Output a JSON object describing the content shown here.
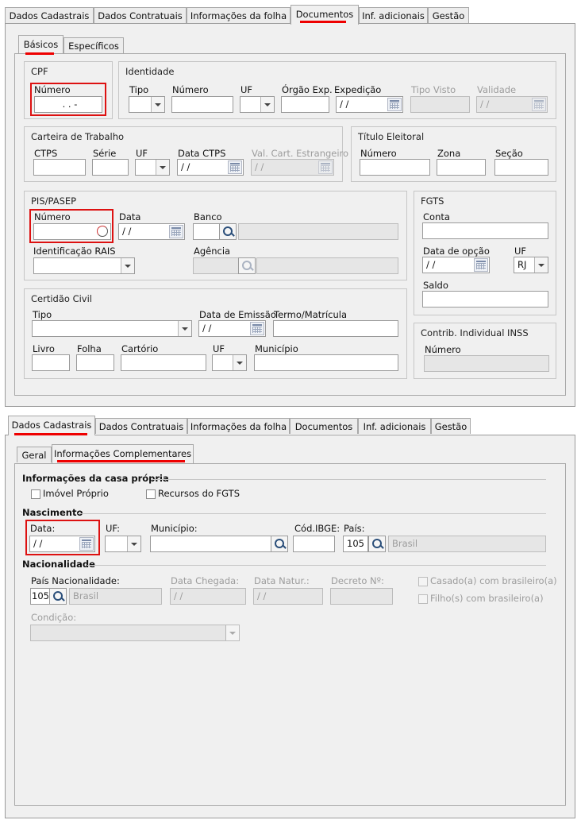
{
  "top": {
    "tabs": [
      "Dados Cadastrais",
      "Dados Contratuais",
      "Informações da folha",
      "Documentos",
      "Inf. adicionais",
      "Gestão"
    ],
    "subtabs": [
      "Básicos",
      "Específicos"
    ],
    "cpf": {
      "title": "CPF",
      "numero_label": "Número",
      "numero_value": ". . -"
    },
    "identidade": {
      "title": "Identidade",
      "tipo_label": "Tipo",
      "numero_label": "Número",
      "uf_label": "UF",
      "orgao_label": "Órgão Exp.",
      "expedicao_label": "Expedição",
      "expedicao_value": "/ /",
      "tipo_visto_label": "Tipo Visto",
      "validade_label": "Validade",
      "validade_value": "/ /"
    },
    "carteira": {
      "title": "Carteira de Trabalho",
      "ctps_label": "CTPS",
      "serie_label": "Série",
      "uf_label": "UF",
      "data_ctps_label": "Data CTPS",
      "data_ctps_value": "/ /",
      "val_cart_label": "Val. Cart. Estrangeiro",
      "val_cart_value": "/ /"
    },
    "titulo": {
      "title": "Título Eleitoral",
      "numero_label": "Número",
      "zona_label": "Zona",
      "secao_label": "Seção"
    },
    "pis": {
      "title": "PIS/PASEP",
      "numero_label": "Número",
      "data_label": "Data",
      "data_value": "/ /",
      "banco_label": "Banco",
      "rais_label": "Identificação RAIS",
      "agencia_label": "Agência"
    },
    "fgts": {
      "title": "FGTS",
      "conta_label": "Conta",
      "data_opcao_label": "Data de opção",
      "data_opcao_value": "/ /",
      "uf_label": "UF",
      "uf_value": "RJ",
      "saldo_label": "Saldo"
    },
    "certidao": {
      "title": "Certidão Civil",
      "tipo_label": "Tipo",
      "data_emissao_label": "Data de Emissão",
      "data_emissao_value": "/ /",
      "termo_label": "Termo/Matrícula",
      "livro_label": "Livro",
      "folha_label": "Folha",
      "cartorio_label": "Cartório",
      "uf_label": "UF",
      "municipio_label": "Município"
    },
    "inss": {
      "title": "Contrib. Individual INSS",
      "numero_label": "Número"
    }
  },
  "bottom": {
    "tabs": [
      "Dados Cadastrais",
      "Dados Contratuais",
      "Informações da folha",
      "Documentos",
      "Inf. adicionais",
      "Gestão"
    ],
    "subtabs": [
      "Geral",
      "Informações Complementares"
    ],
    "casa": {
      "title": "Informações da casa própria",
      "imovel_label": "Imóvel Próprio",
      "recursos_label": "Recursos do FGTS"
    },
    "nascimento": {
      "title": "Nascimento",
      "data_label": "Data:",
      "data_value": "/ /",
      "uf_label": "UF:",
      "municipio_label": "Município:",
      "cod_ibge_label": "Cód.IBGE:",
      "pais_label": "País:",
      "pais_code": "105",
      "pais_name": "Brasil"
    },
    "nacionalidade": {
      "title": "Nacionalidade",
      "pais_label": "País Nacionalidade:",
      "pais_code": "105",
      "pais_name": "Brasil",
      "data_chegada_label": "Data Chegada:",
      "data_chegada_value": "/ /",
      "data_natur_label": "Data Natur.:",
      "data_natur_value": "/ /",
      "decreto_label": "Decreto Nº:",
      "casado_label": "Casado(a) com brasileiro(a)",
      "filho_label": "Filho(s) com brasileiro(a)",
      "condicao_label": "Condição:"
    }
  }
}
